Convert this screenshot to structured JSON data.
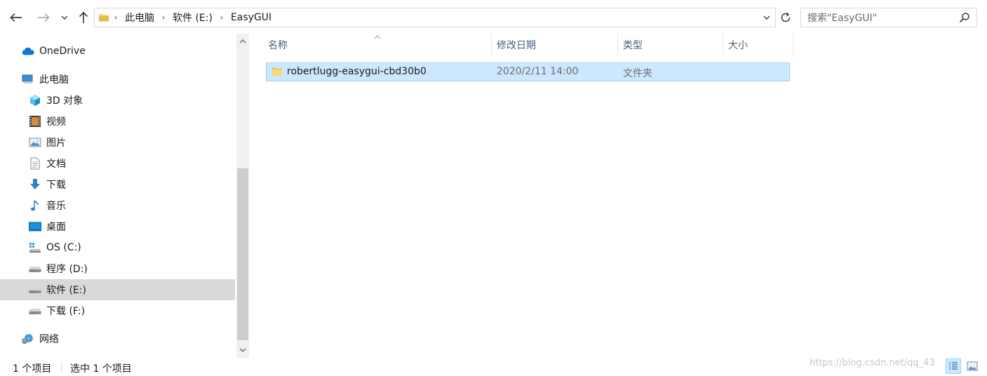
{
  "address": {
    "breadcrumbs": [
      "此电脑",
      "软件 (E:)",
      "EasyGUI"
    ],
    "search_placeholder": "搜索\"EasyGUI\""
  },
  "nav": {
    "onedrive": "OneDrive",
    "this_pc": "此电脑",
    "objects_3d": "3D 对象",
    "videos": "视频",
    "pictures": "图片",
    "documents": "文档",
    "downloads": "下载",
    "music": "音乐",
    "desktop": "桌面",
    "drive_c": "OS (C:)",
    "drive_d": "程序 (D:)",
    "drive_e": "软件 (E:)",
    "drive_f": "下载 (F:)",
    "network": "网络",
    "selected": "软件 (E:)"
  },
  "columns": {
    "name": "名称",
    "date": "修改日期",
    "type": "类型",
    "size": "大小"
  },
  "files": [
    {
      "name": "robertlugg-easygui-cbd30b0",
      "date": "2020/2/11 14:00",
      "type": "文件夹",
      "size": ""
    }
  ],
  "status": {
    "item_count": "1 个项目",
    "selected_count": "选中 1 个项目"
  },
  "watermark": "https://blog.csdn.net/qq_43",
  "icons": {
    "back": "back-arrow-icon",
    "forward": "forward-arrow-icon",
    "recent": "chevron-down-icon",
    "up": "up-arrow-icon",
    "refresh": "refresh-icon",
    "search": "search-icon",
    "folder": "folder-icon"
  },
  "colors": {
    "selection_bg": "#cce8ff",
    "selection_border": "#99d1ff",
    "nav_selected_bg": "#d9d9d9",
    "header_text": "#4c607a",
    "folder_yellow": "#f8d775"
  }
}
